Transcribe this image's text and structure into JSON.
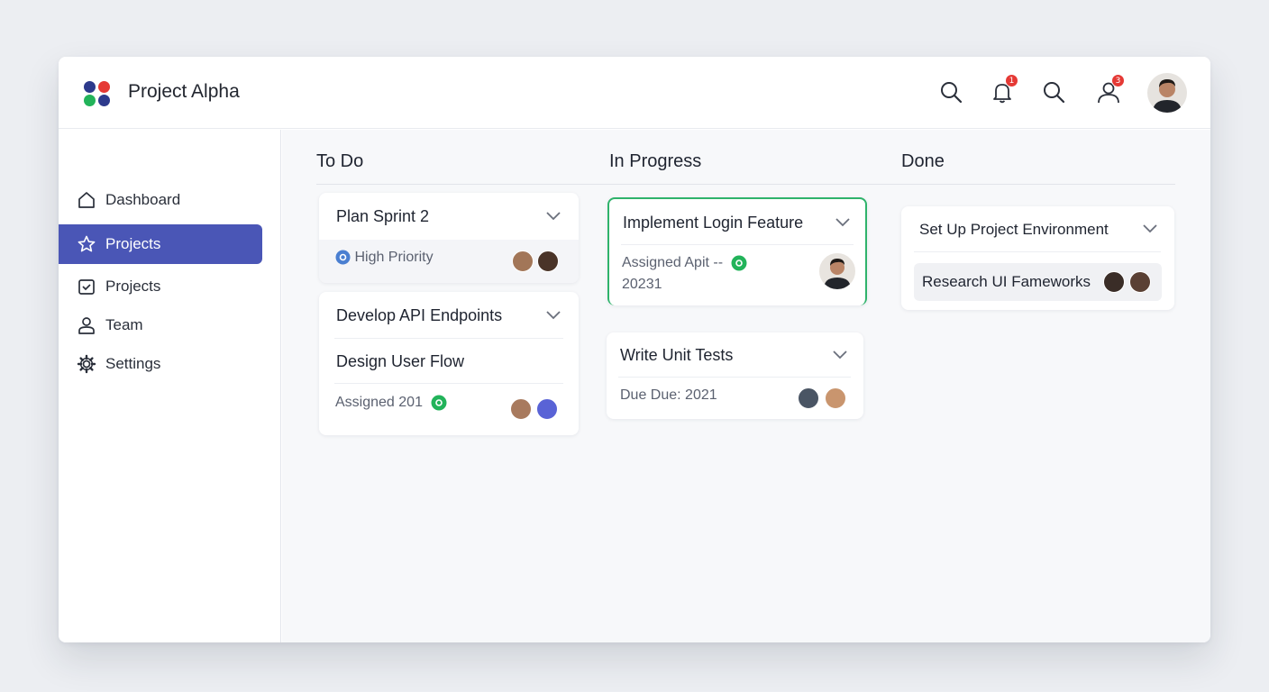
{
  "app": {
    "title": "Project Alpha"
  },
  "topbar": {
    "icons": [
      "search-icon",
      "bell-icon",
      "search-icon",
      "user-icon"
    ],
    "bell_badge": "1",
    "user_badge": "3"
  },
  "sidebar": {
    "items": [
      {
        "label": "Dashboard",
        "icon": "home-icon"
      },
      {
        "label": "Projects",
        "icon": "star-icon",
        "active": true
      },
      {
        "label": "Projects",
        "icon": "calendar-icon"
      },
      {
        "label": "Team",
        "icon": "person-icon"
      },
      {
        "label": "Settings",
        "icon": "gear-icon"
      }
    ]
  },
  "board": {
    "columns": [
      {
        "title": "To Do",
        "cards": [
          {
            "title": "Plan Sprint 2",
            "meta": "High Priority"
          },
          {
            "title": "Develop API Endpoints",
            "subtitle": "Design User Flow",
            "meta": "Assigned 201"
          }
        ]
      },
      {
        "title": "In Progress",
        "cards": [
          {
            "title": "Implement Login Feature",
            "meta_line1": "Assigned Apit --",
            "meta_line2": "20231"
          },
          {
            "title": "Write Unit Tests",
            "meta": "Due Due: 2021"
          }
        ]
      },
      {
        "title": "Done",
        "cards": [
          {
            "title": "Set Up Project Environment",
            "subtitle": "Research UI Fameworks"
          }
        ]
      }
    ]
  },
  "colors": {
    "accent": "#4a56b6",
    "in_progress_border": "#2fb36b",
    "badge": "#e53935",
    "status_green": "#22b35a",
    "status_blue": "#4a7fd1"
  }
}
